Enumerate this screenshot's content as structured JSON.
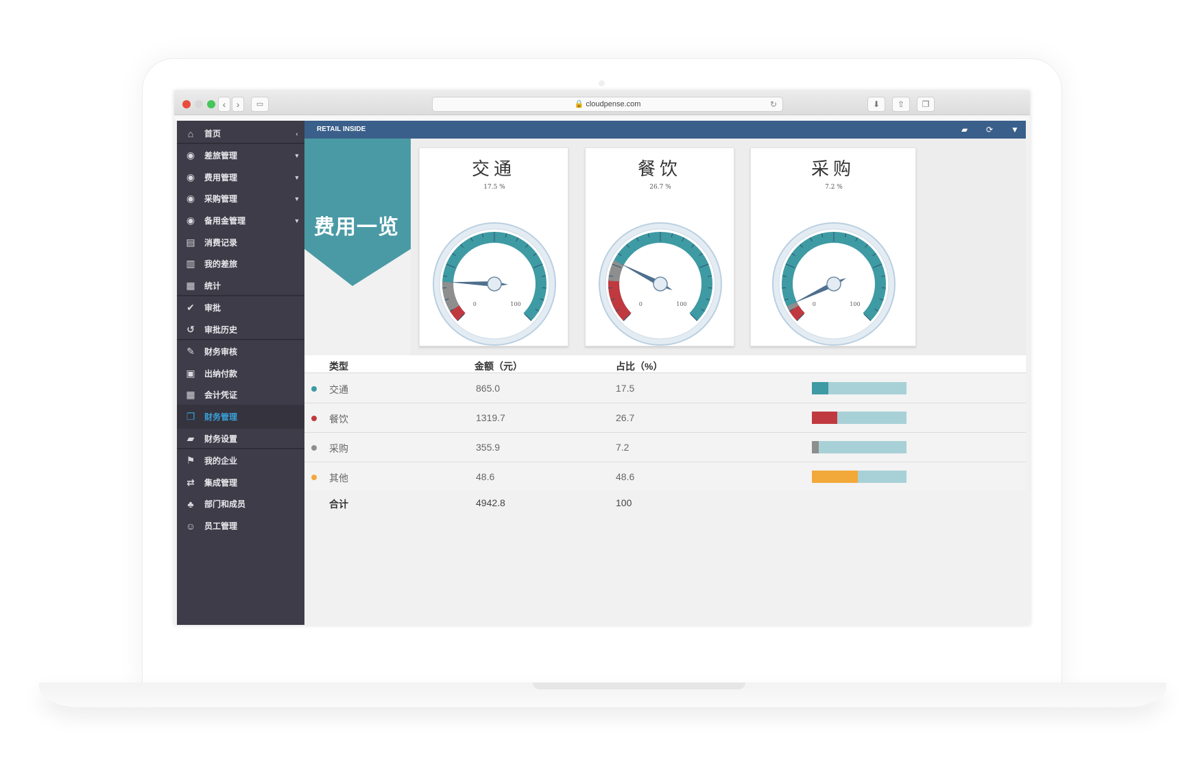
{
  "browser": {
    "url": "cloudpense.com",
    "lock_icon": "lock-icon",
    "reload_icon": "reload-icon",
    "back_icon": "chevron-left-icon",
    "forward_icon": "chevron-right-icon",
    "sidebar_toggle_icon": "sidebar-icon",
    "download_icon": "download-icon",
    "share_icon": "share-icon",
    "tabs_icon": "tabs-icon"
  },
  "sidebar": {
    "items": [
      {
        "label": "首页",
        "icon": "home-icon",
        "glyph": "⌂",
        "arrow": "‹"
      },
      {
        "label": "差旅管理",
        "icon": "travel-icon",
        "glyph": "◉",
        "arrow": "▼"
      },
      {
        "label": "费用管理",
        "icon": "expense-icon",
        "glyph": "◉",
        "arrow": "▼"
      },
      {
        "label": "采购管理",
        "icon": "purchase-icon",
        "glyph": "◉",
        "arrow": "▼"
      },
      {
        "label": "备用金管理",
        "icon": "reserve-icon",
        "glyph": "◉",
        "arrow": "▼"
      },
      {
        "label": "消费记录",
        "icon": "record-icon",
        "glyph": "▤",
        "arrow": ""
      },
      {
        "label": "我的差旅",
        "icon": "suitcase-icon",
        "glyph": "▥",
        "arrow": ""
      },
      {
        "label": "统计",
        "icon": "chart-icon",
        "glyph": "▦",
        "arrow": ""
      },
      {
        "label": "审批",
        "icon": "check-icon",
        "glyph": "✔",
        "arrow": ""
      },
      {
        "label": "审批历史",
        "icon": "history-icon",
        "glyph": "↺",
        "arrow": ""
      },
      {
        "label": "财务审核",
        "icon": "edit-icon",
        "glyph": "✎",
        "arrow": ""
      },
      {
        "label": "出纳付款",
        "icon": "money-icon",
        "glyph": "▣",
        "arrow": ""
      },
      {
        "label": "会计凭证",
        "icon": "calculator-icon",
        "glyph": "▦",
        "arrow": ""
      },
      {
        "label": "财务管理",
        "icon": "copy-icon",
        "glyph": "❐",
        "arrow": ""
      },
      {
        "label": "财务设置",
        "icon": "book-icon",
        "glyph": "▰",
        "arrow": ""
      },
      {
        "label": "我的企业",
        "icon": "flag-icon",
        "glyph": "⚑",
        "arrow": ""
      },
      {
        "label": "集成管理",
        "icon": "retweet-icon",
        "glyph": "⇄",
        "arrow": ""
      },
      {
        "label": "部门和成员",
        "icon": "sitemap-icon",
        "glyph": "♣",
        "arrow": ""
      },
      {
        "label": "员工管理",
        "icon": "add-user-icon",
        "glyph": "☺",
        "arrow": ""
      }
    ],
    "active_index": 13
  },
  "content": {
    "bar_title": "RETAIL INSIDE",
    "book_icon": "book-icon",
    "refresh_icon": "refresh-icon",
    "filter_icon": "filter-icon",
    "banner": "费用一览",
    "banner_color": "#4a9aa5"
  },
  "gauges": [
    {
      "title": "交通",
      "percent_label": "17.5 %",
      "value": 17.5,
      "min_label": "0",
      "max_label": "100",
      "color": "#3e9aa3",
      "marker": "#8e8e8e"
    },
    {
      "title": "餐饮",
      "percent_label": "26.7 %",
      "value": 26.7,
      "min_label": "0",
      "max_label": "100",
      "color": "#3e9aa3",
      "marker": "#c0393f"
    },
    {
      "title": "采购",
      "percent_label": "7.2 %",
      "value": 7.2,
      "min_label": "0",
      "max_label": "100",
      "color": "#3e9aa3",
      "marker": "#8e8e8e"
    }
  ],
  "table": {
    "headers": {
      "type": "类型",
      "amount": "金额（元）",
      "ratio": "占比（%）"
    },
    "rows": [
      {
        "type": "交通",
        "amount": "865.0",
        "ratio": "17.5",
        "value": 17.5,
        "color": "#3e9aa3"
      },
      {
        "type": "餐饮",
        "amount": "1319.7",
        "ratio": "26.7",
        "value": 26.7,
        "color": "#c0393f"
      },
      {
        "type": "采购",
        "amount": "355.9",
        "ratio": "7.2",
        "value": 7.2,
        "color": "#8e8e8e"
      },
      {
        "type": "其他",
        "amount": "48.6",
        "ratio": "48.6",
        "value": 48.6,
        "color": "#f3a83a"
      }
    ],
    "total": {
      "label": "合计",
      "amount": "4942.8",
      "ratio": "100"
    }
  }
}
